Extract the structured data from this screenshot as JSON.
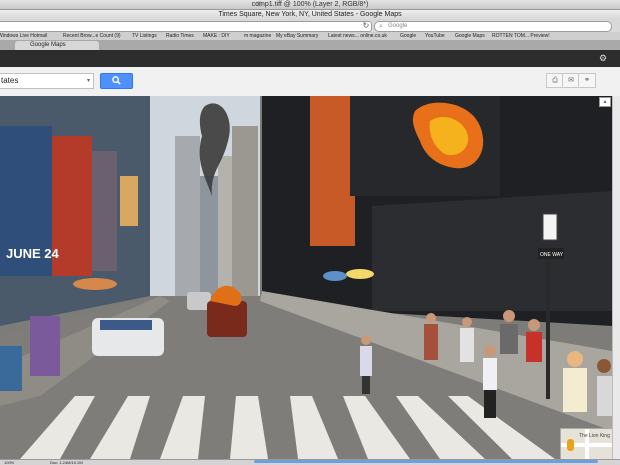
{
  "photoshop": {
    "document_title": "comp1.tiff @ 100% (Layer 2, RGB/8*)",
    "zoom": "100%",
    "doc_size": "Doc: 1.24M/10.2M"
  },
  "browser": {
    "window_title": "Times Square, New York, NY, United States - Google Maps",
    "search_placeholder": "Google",
    "reload_icon": "↻",
    "bookmarks": [
      "Windows Live Hotmail",
      "Recent Brow...e Count (9)",
      "TV Listings",
      "Radio Times",
      "MAKE : DIY",
      "m magazine",
      "My eBay Summary",
      "Latest news... online.co.uk",
      "Google",
      "YouTube",
      "Google Maps",
      "ROTTEN TOM... Preview!"
    ],
    "active_tab": "Google Maps"
  },
  "maps": {
    "search_value": "tates",
    "search_button_icon": "search-icon",
    "tools": [
      "print-icon",
      "mail-icon",
      "link-icon"
    ],
    "settings_icon": "gear-icon"
  },
  "street_view": {
    "billboard_text": "JUNE 24",
    "sign_text": "ONE WAY",
    "minimap_label": "The Lion King",
    "accent_colors": {
      "fire": "#e8701a",
      "sky": "#cfd6de",
      "smoke": "#3b3b3b"
    }
  }
}
